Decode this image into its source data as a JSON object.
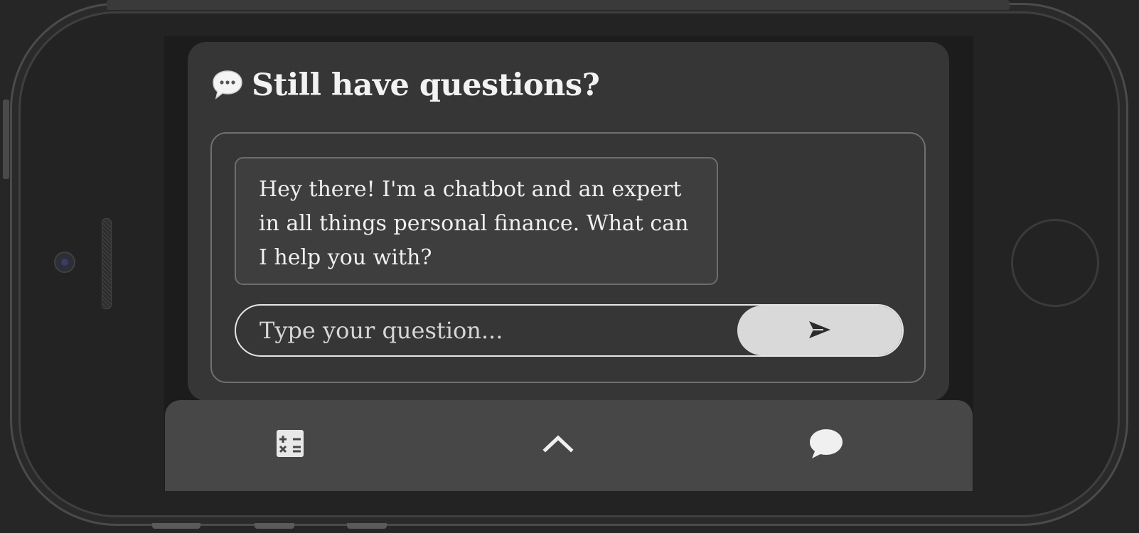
{
  "chat": {
    "title": "Still have questions?",
    "bot_message": "Hey there! I'm a chatbot and an expert in all things personal finance. What can I help you with?",
    "input_placeholder": "Type your question...",
    "send_icon": "send-arrow-icon"
  },
  "bottom_nav": {
    "items": [
      {
        "icon": "calculator-icon"
      },
      {
        "icon": "chevron-up-icon"
      },
      {
        "icon": "chat-bubble-icon"
      }
    ]
  },
  "colors": {
    "page_background": "#262626",
    "card_background": "#363636",
    "nav_background": "#474747",
    "send_button": "#d9d9d9",
    "text": "#f2f2f2"
  }
}
